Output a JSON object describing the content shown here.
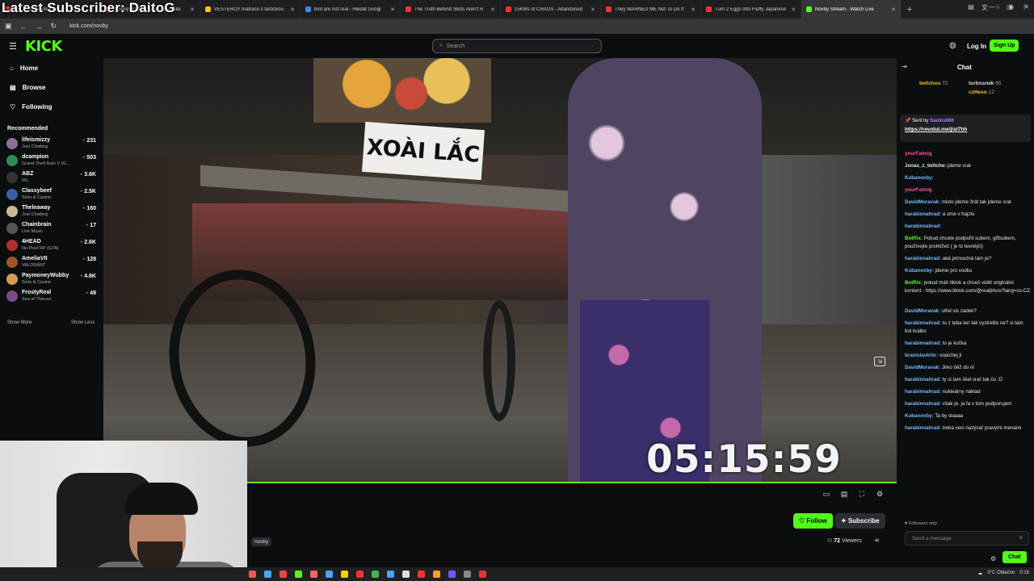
{
  "overlay": {
    "latest_subscriber": "Latest Subscriber: DaitoG"
  },
  "browser": {
    "tabs": [
      {
        "title": "FROM THE SWAMP",
        "color": "#e33"
      },
      {
        "title": "Attempted the Creb Track, faile",
        "color": "#e33"
      },
      {
        "title": "VESTERÖY matrace s taštičkou",
        "color": "#f1c40f"
      },
      {
        "title": "bird are not real - Hledat Googl",
        "color": "#4285f4"
      },
      {
        "title": "The Truth Behind 'Birds Aren't R",
        "color": "#e33"
      },
      {
        "title": "15KMs of CHAOS - Abandoned",
        "color": "#e33"
      },
      {
        "title": "They WARNED ME Not To Do It",
        "color": "#e33"
      },
      {
        "title": "Turn 2 Eggs Into Fluffy Japanese",
        "color": "#e33"
      },
      {
        "title": "Novby Stream - Watch Live",
        "color": "#53fc18",
        "active": true
      }
    ],
    "new_tab": "+",
    "url": "kick.com/novby"
  },
  "header": {
    "logo": "KICK",
    "search_placeholder": "Search",
    "login": "Log In",
    "signup": "Sign Up"
  },
  "sidebar": {
    "nav": [
      {
        "label": "Home",
        "icon": "home-icon"
      },
      {
        "label": "Browse",
        "icon": "browse-icon"
      },
      {
        "label": "Following",
        "icon": "heart-icon"
      }
    ],
    "recommended_title": "Recommended",
    "channels": [
      {
        "name": "lifeismizzy",
        "category": "Just Chatting",
        "viewers": "231",
        "color": "#8e6e9a"
      },
      {
        "name": "dcampion",
        "category": "Grand Theft Auto V (G...",
        "viewers": "503",
        "color": "#2e8b57"
      },
      {
        "name": "ABZ",
        "category": "IRL",
        "viewers": "3.6K",
        "color": "#333333"
      },
      {
        "name": "Classybeef",
        "category": "Slots & Casino",
        "viewers": "2.5K",
        "color": "#3a5fa8"
      },
      {
        "name": "Theleaway",
        "category": "Just Chatting",
        "viewers": "160",
        "color": "#c8b89a"
      },
      {
        "name": "Chainbrain",
        "category": "Live Music",
        "viewers": "17",
        "color": "#555555"
      },
      {
        "name": "4HEAD",
        "category": "No Pixel RP (GTA)",
        "viewers": "2.6K",
        "color": "#b03030"
      },
      {
        "name": "AmeliaVII",
        "category": "VALORANT",
        "viewers": "128",
        "color": "#a0522d"
      },
      {
        "name": "PaymoneyWubby",
        "category": "Slots & Casino",
        "viewers": "4.6K",
        "color": "#d2a04a"
      },
      {
        "name": "FrostyReal",
        "category": "Sea of Thieves",
        "viewers": "49",
        "color": "#7a4a8a"
      }
    ],
    "show_more": "Show More",
    "show_less": "Show Less"
  },
  "video": {
    "sign_text": "XOÀI LẮC",
    "timer": "05:15:59"
  },
  "channel": {
    "name": "novby",
    "follow": "Follow",
    "subscribe": "Subscribe",
    "viewers_count": "72",
    "viewers_label": "Viewers"
  },
  "chat": {
    "title": "Chat",
    "gifters": [
      {
        "name": "twitchos",
        "count": "72",
        "color": "#f1c40f"
      },
      {
        "name": "turbosnek",
        "count": "65",
        "color": "#ddd"
      },
      {
        "name": "czHeso",
        "count": "12",
        "color": "#f1c40f"
      }
    ],
    "pinned": {
      "sent_by_label": "Sent by",
      "sender": "Saulos666",
      "link": "https://revolut.me/jist7hh"
    },
    "messages": [
      {
        "user": "",
        "text": "",
        "color": "#6fcf97"
      },
      {
        "user": "yourFatmig",
        "text": "",
        "color": "#ff4fa0"
      },
      {
        "user": "Jonas_z_twitche:",
        "text": "jdeme srat",
        "color": "#e6e6e6"
      },
      {
        "user": "Kubanovby:",
        "text": "",
        "color": "#7ab8ff"
      },
      {
        "user": "yourFatmig",
        "text": "",
        "color": "#ff4fa0"
      },
      {
        "user": "DavidMoravak:",
        "text": "misto jdeme žrát tak jdeme srat",
        "color": "#7ab8ff"
      },
      {
        "user": "harabinnahrad:",
        "text": "a sme v hajzlu",
        "color": "#7ab8ff"
      },
      {
        "user": "harabinnahrad:",
        "text": "",
        "color": "#7ab8ff"
      },
      {
        "user": "BotRix:",
        "text": "Pokud chcete podpořit subem, giftsubem, používejte prohlížeč ( je to levnější)",
        "color": "#53fc18"
      },
      {
        "user": "harabinnahrad:",
        "text": "aká princezná tam je?",
        "color": "#7ab8ff"
      },
      {
        "user": "Kubanovby:",
        "text": "jdeme pro vodku",
        "color": "#7ab8ff"
      },
      {
        "user": "BotRix:",
        "text": "pokud máš tiktok a chceš vidět originální kontent - https://www.tiktok.com/@realjirkos?lang=cs-CZ",
        "color": "#53fc18"
      },
      {
        "user": "DavidMoravak:",
        "text": "utřel sis zadek?",
        "color": "#7ab8ff"
      },
      {
        "user": "harabinnahrad:",
        "text": "to z teba len tak vystrelilo ne? si tam bol krátko",
        "color": "#7ab8ff"
      },
      {
        "user": "harabinnahrad:",
        "text": "to je kočka",
        "color": "#7ab8ff"
      },
      {
        "user": "branislavkrbr:",
        "text": "vopichej jí",
        "color": "#7ab8ff"
      },
      {
        "user": "DavidMoravak:",
        "text": "Jirko běž do ní",
        "color": "#7ab8ff"
      },
      {
        "user": "harabinnahrad:",
        "text": "ty si tam išiel srať tak čo :D",
        "color": "#7ab8ff"
      },
      {
        "user": "harabinnahrad:",
        "text": "nukleárny náklad",
        "color": "#7ab8ff"
      },
      {
        "user": "harabinnahrad:",
        "text": "však je. ja fa v tom podporujem",
        "color": "#7ab8ff"
      },
      {
        "user": "Kubanovby:",
        "text": "Ta by slaaaa",
        "color": "#7ab8ff"
      },
      {
        "user": "harabinnahrad:",
        "text": "treba veci nazývať pravými menami",
        "color": "#7ab8ff"
      }
    ],
    "followers_only": "Followers only",
    "send_placeholder": "Send a message",
    "chat_button": "Chat"
  },
  "taskbar": {
    "weather": "3°C Oblačno",
    "time": "0:16"
  }
}
